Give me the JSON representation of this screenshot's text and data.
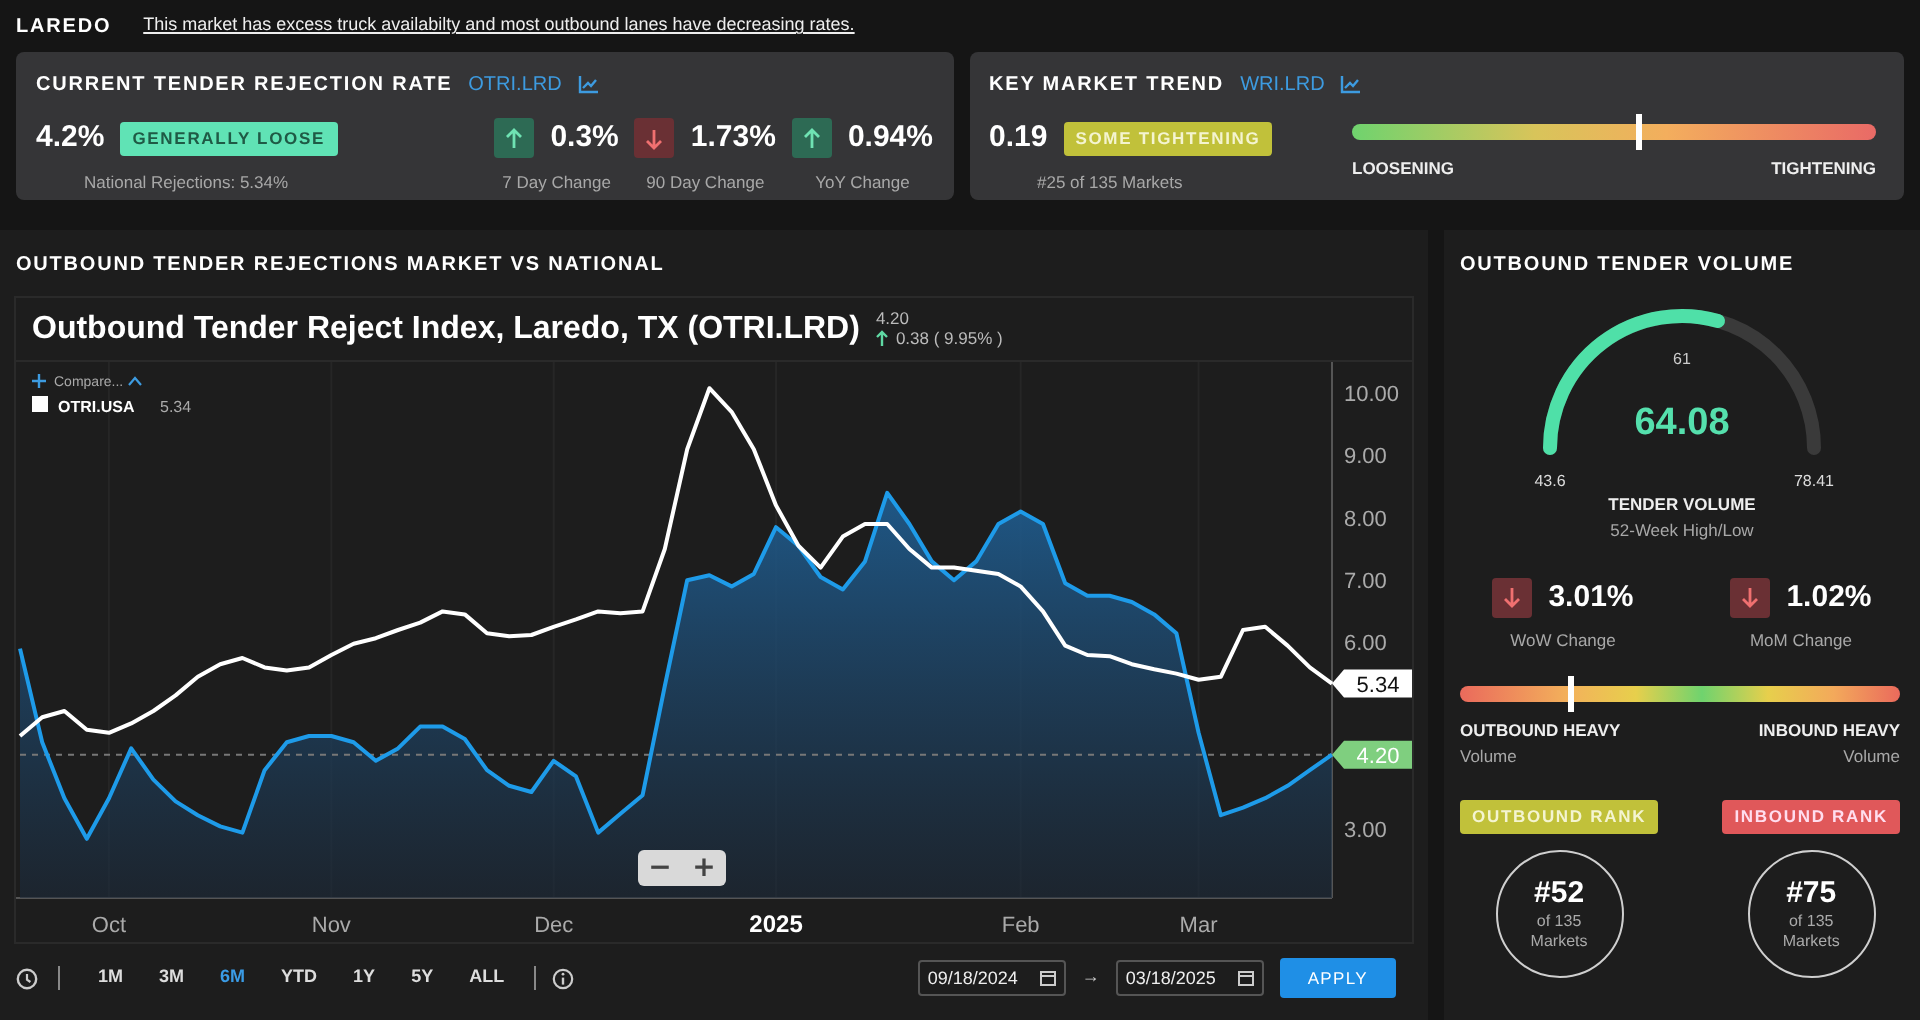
{
  "header": {
    "market": "LAREDO",
    "summary": "This market has excess truck availabilty and most outbound lanes have decreasing rates."
  },
  "rejection_card": {
    "title": "CURRENT TENDER REJECTION RATE",
    "ticker": "OTRI.LRD",
    "value": "4.2%",
    "badge": "GENERALLY LOOSE",
    "national": "National Rejections: 5.34%",
    "changes": [
      {
        "kind": "up",
        "value": "0.3%",
        "label": "7 Day Change"
      },
      {
        "kind": "down",
        "value": "1.73%",
        "label": "90 Day Change"
      },
      {
        "kind": "up",
        "value": "0.94%",
        "label": "YoY Change"
      }
    ]
  },
  "trend_card": {
    "title": "KEY MARKET TREND",
    "ticker": "WRI.LRD",
    "value": "0.19",
    "badge": "SOME TIGHTENING",
    "rank": "#25 of 135 Markets",
    "scale": {
      "level": 0.544,
      "left_label": "LOOSENING",
      "right_label": "TIGHTENING"
    }
  },
  "chart_panel": {
    "title": "OUTBOUND TENDER REJECTIONS MARKET VS NATIONAL",
    "chart_title": "Outbound Tender Reject Index, Laredo, TX (OTRI.LRD)",
    "last_value": "4.20",
    "change": "0.38 ( 9.95% )",
    "compare": "Compare...",
    "legend_value": "5.34",
    "chart_data": {
      "type": "line",
      "categories": [
        null,
        null,
        null,
        null,
        "Oct",
        null,
        null,
        null,
        null,
        null,
        null,
        null,
        null,
        null,
        "Nov",
        null,
        null,
        null,
        null,
        null,
        null,
        null,
        null,
        null,
        "Dec",
        null,
        null,
        null,
        null,
        null,
        null,
        null,
        null,
        null,
        "2025",
        null,
        null,
        null,
        null,
        null,
        null,
        null,
        null,
        null,
        null,
        "Feb",
        null,
        null,
        null,
        null,
        null,
        null,
        null,
        "Mar",
        null,
        null,
        null,
        null,
        null,
        null
      ],
      "series": [
        {
          "type": "area",
          "color": "#1e9be9",
          "values": [
            5.9,
            4.4,
            3.5,
            2.85,
            3.5,
            4.3,
            3.8,
            3.45,
            3.23,
            3.05,
            2.95,
            3.95,
            4.4,
            4.5,
            4.5,
            4.4,
            4.1,
            4.3,
            4.65,
            4.65,
            4.45,
            3.95,
            3.7,
            3.6,
            4.1,
            3.85,
            2.95,
            3.25,
            3.55,
            5.3,
            7.0,
            7.08,
            6.9,
            7.1,
            7.85,
            7.55,
            7.05,
            6.85,
            7.3,
            8.4,
            7.9,
            7.3,
            7.0,
            7.3,
            7.9,
            8.1,
            7.9,
            6.95,
            6.75,
            6.75,
            6.65,
            6.45,
            6.15,
            4.55,
            3.23,
            3.35,
            3.5,
            3.7,
            3.95,
            4.2
          ]
        },
        {
          "type": "line",
          "name": "OTRI.USA",
          "color": "#ffffff",
          "values": [
            4.5,
            4.8,
            4.9,
            4.6,
            4.55,
            4.7,
            4.9,
            5.15,
            5.45,
            5.65,
            5.75,
            5.6,
            5.55,
            5.6,
            5.8,
            5.98,
            6.07,
            6.2,
            6.32,
            6.5,
            6.45,
            6.15,
            6.1,
            6.12,
            6.25,
            6.37,
            6.5,
            6.47,
            6.5,
            7.5,
            9.1,
            10.08,
            9.7,
            9.1,
            8.2,
            7.55,
            7.2,
            7.7,
            7.9,
            7.9,
            7.5,
            7.2,
            7.2,
            7.15,
            7.1,
            6.9,
            6.5,
            5.95,
            5.8,
            5.78,
            5.65,
            5.57,
            5.5,
            5.4,
            5.45,
            6.2,
            6.25,
            5.95,
            5.6,
            5.34
          ]
        }
      ],
      "ylim": [
        1.9,
        10.5
      ],
      "yticks": [
        {
          "value": 3,
          "label": "3.00"
        },
        {
          "value": 6,
          "label": "6.00"
        },
        {
          "value": 7,
          "label": "7.00"
        },
        {
          "value": 8,
          "label": "8.00"
        },
        {
          "value": 9,
          "label": "9.00"
        },
        {
          "value": 10,
          "label": "10.00"
        }
      ],
      "grid": true,
      "ref_lines": [
        {
          "axis": "y",
          "value": 4.2
        }
      ],
      "annotations": [
        "5.34",
        "4.20"
      ]
    },
    "zoom_buttons": [
      "−",
      "+"
    ],
    "ranges": [
      {
        "label": "1M",
        "selected": false
      },
      {
        "label": "3M",
        "selected": false
      },
      {
        "label": "6M",
        "selected": true
      },
      {
        "label": "YTD",
        "selected": false
      },
      {
        "label": "1Y",
        "selected": false
      },
      {
        "label": "5Y",
        "selected": false
      },
      {
        "label": "ALL",
        "selected": false
      }
    ],
    "start_date": "09/18/2024",
    "date_separator": "→",
    "end_date": "03/18/2025",
    "apply": "APPLY"
  },
  "volume_panel": {
    "title": "OUTBOUND TENDER VOLUME",
    "gauge": {
      "level": 0.588,
      "value": "64.08",
      "marker": "61",
      "min": "43.6",
      "max": "78.41",
      "label": "TENDER VOLUME",
      "sublabel": "52-Week High/Low"
    },
    "changes": [
      {
        "kind": "down",
        "value": "3.01%",
        "label": "WoW Change"
      },
      {
        "kind": "down",
        "value": "1.02%",
        "label": "MoM Change"
      }
    ],
    "balance": {
      "level": 0.25,
      "left_label": "OUTBOUND HEAVY",
      "left_sub": "Volume",
      "right_label": "INBOUND HEAVY",
      "right_sub": "Volume"
    },
    "ranks": [
      {
        "kind": "outbound",
        "badge": "OUTBOUND RANK",
        "value": "#52",
        "of": "of 135 Markets"
      },
      {
        "kind": "inbound",
        "badge": "INBOUND RANK",
        "value": "#75",
        "of": "of 135 Markets"
      }
    ]
  }
}
